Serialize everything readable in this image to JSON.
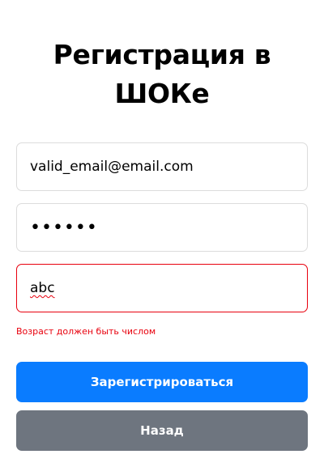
{
  "form": {
    "title": "Регистрация в ШОКе",
    "email": {
      "value": "valid_email@email.com"
    },
    "password": {
      "value": "••••••"
    },
    "age": {
      "value": "abc",
      "error": "Возраст должен быть числом"
    },
    "register_label": "Зарегистрироваться",
    "back_label": "Назад"
  },
  "colors": {
    "primary": "#0a7cff",
    "secondary": "#6e757f",
    "error": "#e8000d",
    "border": "#dcdcdc"
  }
}
